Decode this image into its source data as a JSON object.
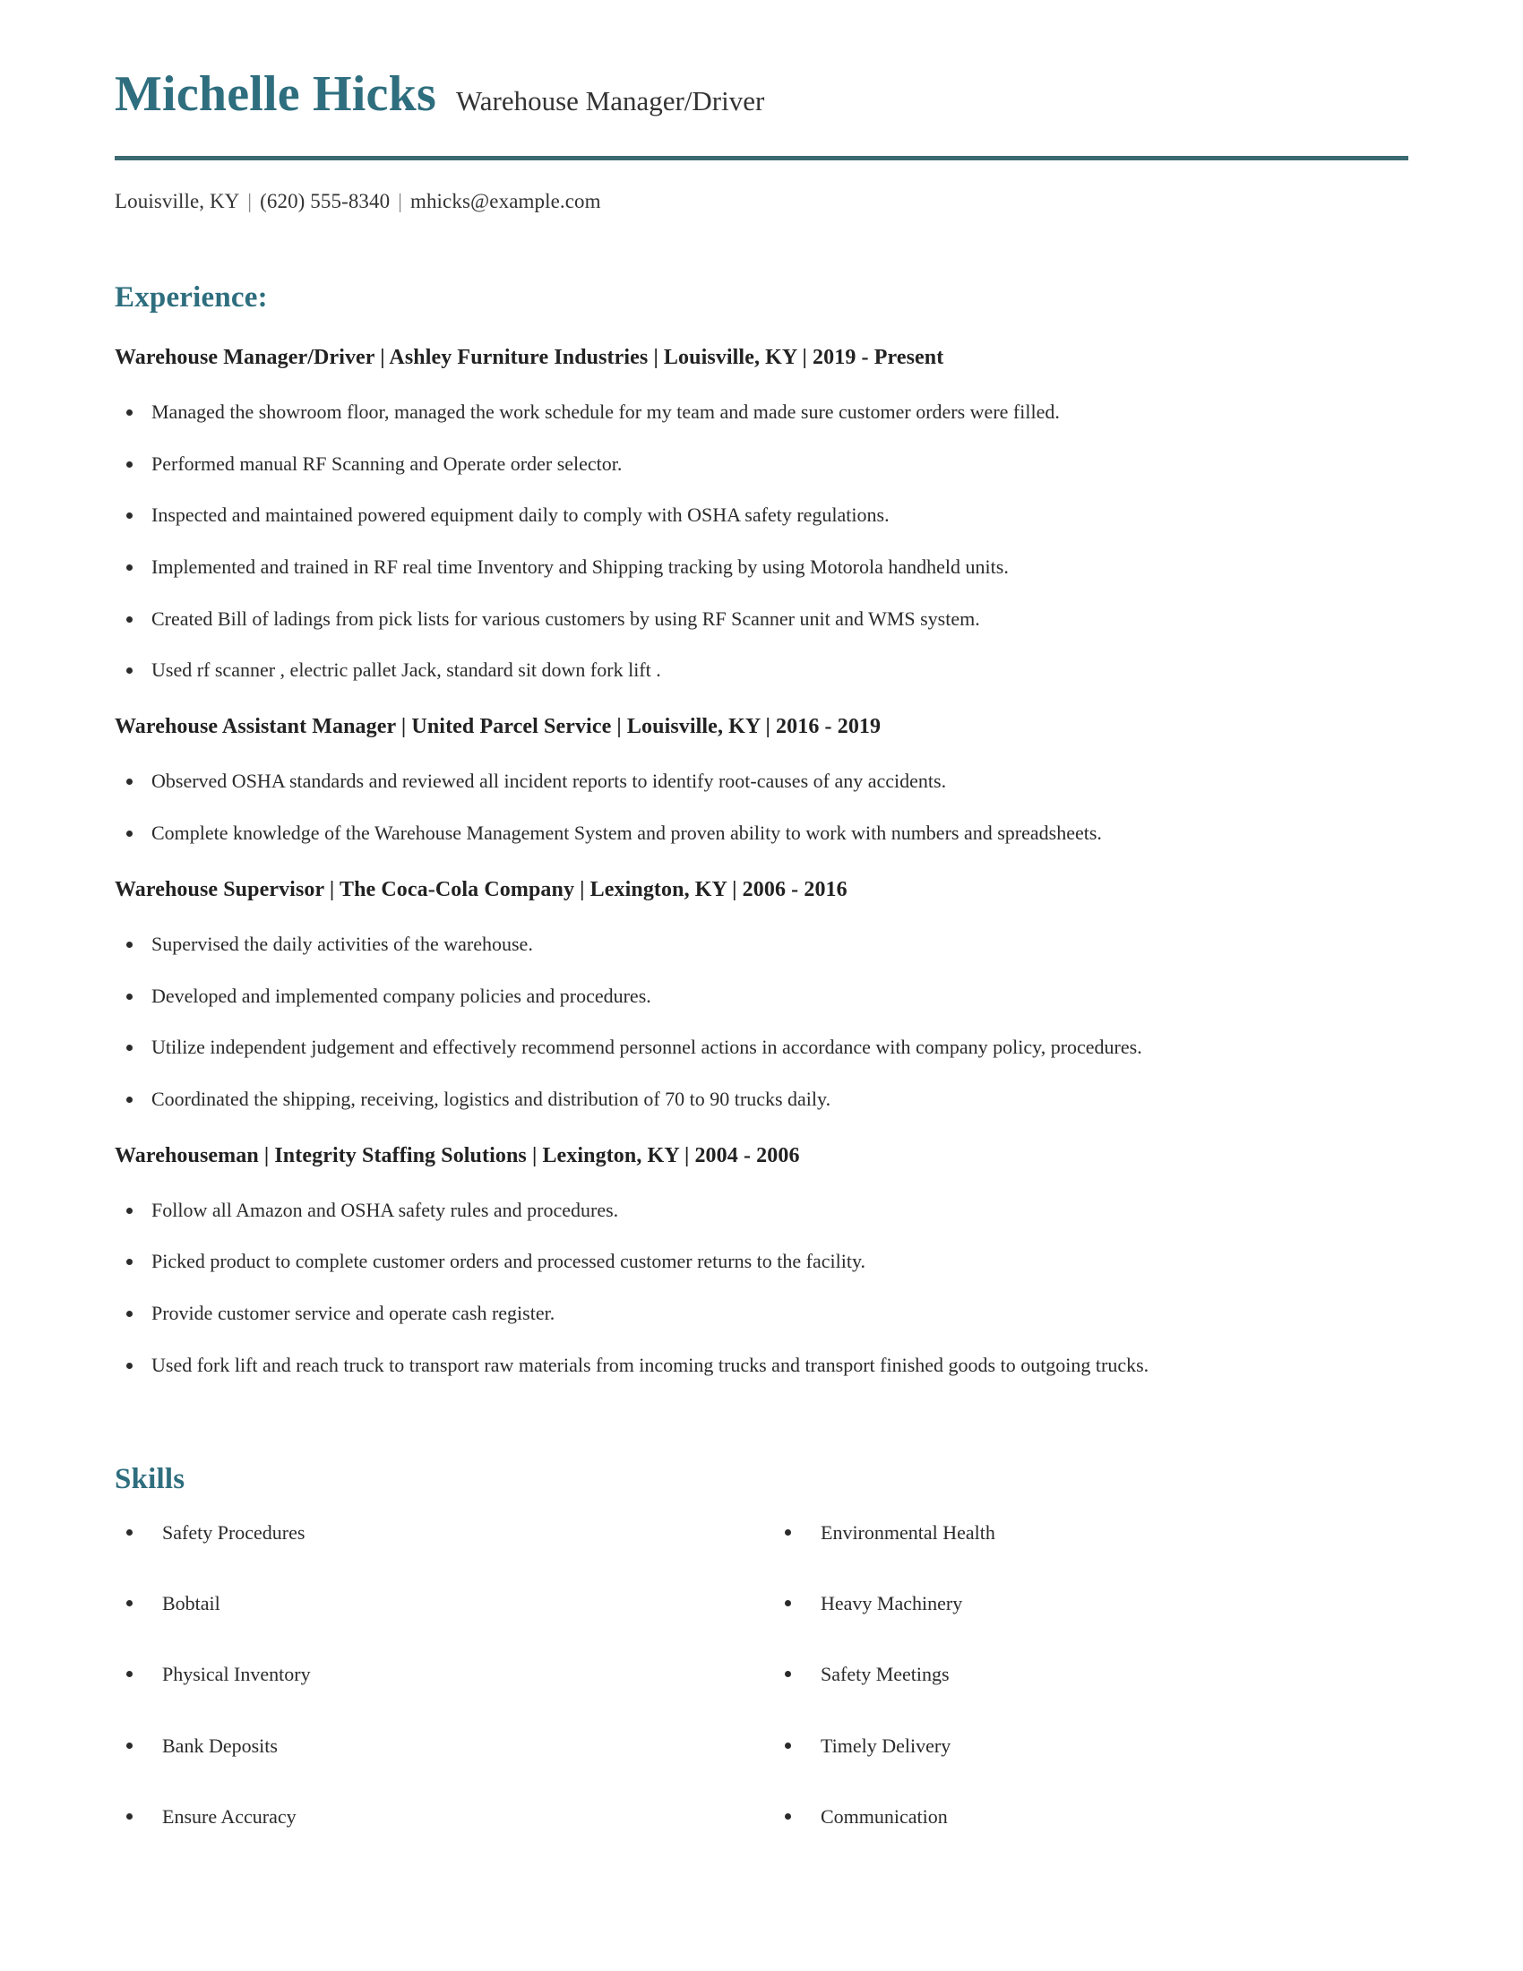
{
  "theme": {
    "accent": "#2e6e7e",
    "rule": "#3c6a72",
    "text": "#2b2b2b",
    "heading_text": "#222222",
    "background": "#ffffff"
  },
  "header": {
    "name": "Michelle Hicks",
    "headline": "Warehouse Manager/Driver",
    "contact": {
      "location": "Louisville, KY",
      "phone": "(620) 555-8340",
      "email": "mhicks@example.com",
      "separator": "|"
    }
  },
  "experience": {
    "title": "Experience:",
    "jobs": [
      {
        "heading": "Warehouse Manager/Driver | Ashley Furniture Industries | Louisville, KY | 2019 - Present",
        "bullets": [
          "Managed the showroom floor, managed the work schedule for my team and made sure customer orders were filled.",
          "Performed manual RF Scanning and Operate order selector.",
          "Inspected and maintained powered equipment daily to comply with OSHA safety regulations.",
          "Implemented and trained in RF real time Inventory and Shipping tracking by using Motorola handheld units.",
          "Created Bill of ladings from pick lists for various customers by using RF Scanner unit and WMS system.",
          "Used rf scanner , electric pallet Jack, standard sit down fork lift ."
        ]
      },
      {
        "heading": "Warehouse Assistant Manager | United Parcel Service | Louisville, KY | 2016 - 2019",
        "bullets": [
          "Observed OSHA standards and reviewed all incident reports to identify root-causes of any accidents.",
          "Complete knowledge of the Warehouse Management System and proven ability to work with numbers and spreadsheets."
        ]
      },
      {
        "heading": "Warehouse Supervisor | The Coca-Cola Company | Lexington, KY | 2006 - 2016",
        "bullets": [
          "Supervised the daily activities of the warehouse.",
          "Developed and implemented company policies and procedures.",
          "Utilize independent judgement and effectively recommend personnel actions in accordance with company policy, procedures.",
          "Coordinated the shipping, receiving, logistics and distribution of 70 to 90 trucks daily."
        ]
      },
      {
        "heading": "Warehouseman | Integrity Staffing Solutions | Lexington, KY | 2004 - 2006",
        "bullets": [
          "Follow all Amazon and OSHA safety rules and procedures.",
          "Picked product to complete customer orders and processed customer returns to the facility.",
          "Provide customer service and operate cash register.",
          "Used fork lift and reach truck to transport raw materials from incoming trucks and transport finished goods to outgoing trucks."
        ]
      }
    ]
  },
  "skills": {
    "title": "Skills",
    "column_left": [
      "Safety Procedures",
      "Bobtail",
      "Physical Inventory",
      "Bank Deposits",
      "Ensure Accuracy"
    ],
    "column_right": [
      "Environmental Health",
      "Heavy Machinery",
      "Safety Meetings",
      "Timely Delivery",
      "Communication"
    ]
  }
}
